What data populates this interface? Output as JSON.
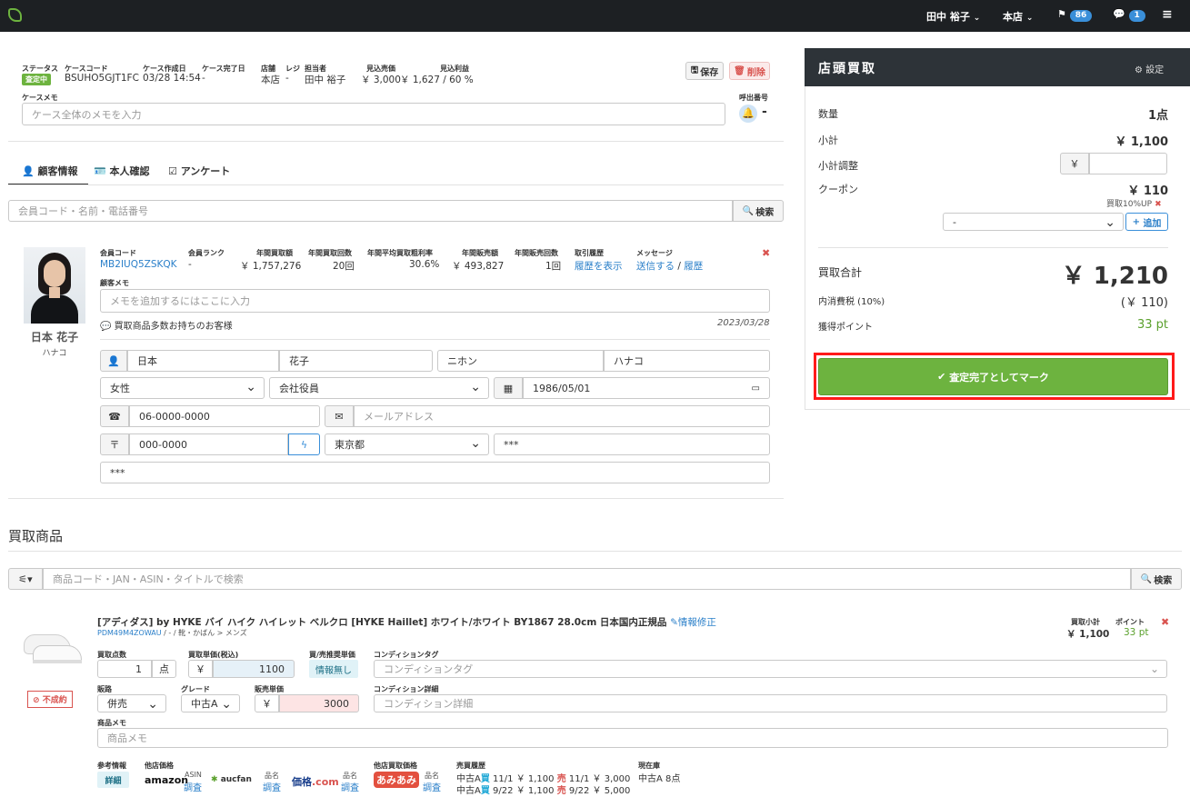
{
  "topbar": {
    "user": "田中 裕子",
    "store": "本店",
    "flag_count": "86",
    "chat_count": "1"
  },
  "case": {
    "status_label": "ステータス",
    "status_value": "査定中",
    "code_label": "ケースコード",
    "code_value": "BSUHO5GJT1FC",
    "created_label": "ケース作成日",
    "created_value": "03/28 14:54",
    "done_label": "ケース完了日",
    "done_value": "-",
    "store_label": "店舗",
    "store_value": "本店",
    "register_label": "レジ",
    "register_value": "-",
    "staff_label": "担当者",
    "staff_value": "田中 裕子",
    "est_sale_label": "見込売価",
    "est_sale_value": "￥ 3,000",
    "est_profit_label": "見込利益",
    "est_profit_value": "￥ 1,627 / 60 %",
    "save_label": "保存",
    "delete_label": "削除",
    "memo_label": "ケースメモ",
    "memo_placeholder": "ケース全体のメモを入力",
    "call_label": "呼出番号",
    "call_value": "-"
  },
  "tabs": [
    {
      "label": "顧客情報"
    },
    {
      "label": "本人確認"
    },
    {
      "label": "アンケート"
    }
  ],
  "member_search": {
    "placeholder": "会員コード・名前・電話番号",
    "button": "検索"
  },
  "customer": {
    "name": "日本 花子",
    "kana": "ハナコ",
    "member_code_label": "会員コード",
    "member_code": "MB2IUQ5ZSKQK",
    "rank_label": "会員ランク",
    "rank": "-",
    "annual_buy_label": "年間買取額",
    "annual_buy": "￥ 1,757,276",
    "annual_buy_count_label": "年間買取回数",
    "annual_buy_count": "20回",
    "avg_margin_label": "年間平均買取粗利率",
    "avg_margin": "30.6%",
    "annual_sale_label": "年間販売額",
    "annual_sale": "￥ 493,827",
    "annual_sale_count_label": "年間販売回数",
    "annual_sale_count": "1回",
    "history_label": "取引履歴",
    "history_link": "履歴を表示",
    "message_label": "メッセージ",
    "message_send": "送信する",
    "message_sep": "/",
    "message_history": "履歴",
    "memo_label": "顧客メモ",
    "memo_placeholder": "メモを追加するにはここに入力",
    "note": "買取商品多数お持ちのお客様",
    "note_date": "2023/03/28",
    "last_name": "日本",
    "first_name": "花子",
    "last_kana": "ニホン",
    "first_kana": "ハナコ",
    "gender": "女性",
    "occupation": "会社役員",
    "birthday": "1986/05/01",
    "phone": "06-0000-0000",
    "email_placeholder": "メールアドレス",
    "zip": "000-0000",
    "prefecture": "東京都",
    "address1": "***",
    "address2": "***"
  },
  "items_section": {
    "title": "買取商品",
    "search_placeholder": "商品コード・JAN・ASIN・タイトルで検索",
    "search_button": "検索"
  },
  "item": {
    "title": "[アディダス] by HYKE バイ ハイク ハイレット ベルクロ [HYKE Haillet] ホワイト/ホワイト BY1867 28.0cm 日本国内正規品",
    "edit_link": "情報修正",
    "code": "PDM49M4ZOWAU",
    "category": " / - / 靴・かばん > メンズ",
    "subtotal_label": "買取小計",
    "subtotal": "￥ 1,100",
    "points_label": "ポイント",
    "points": "33 pt",
    "status_badge": "不成約",
    "qty_label": "買取点数",
    "qty": "1",
    "qty_unit": "点",
    "unit_price_label": "買取単価(税込)",
    "unit_price": "1100",
    "yen": "￥",
    "recommend_label": "買/売推奨単価",
    "recommend_value": "情報無し",
    "condition_tag_label": "コンディションタグ",
    "condition_tag_placeholder": "コンディションタグ",
    "channel_label": "販路",
    "channel": "併売",
    "grade_label": "グレード",
    "grade": "中古A",
    "sale_price_label": "販売単価",
    "sale_price": "3000",
    "condition_detail_label": "コンディション詳細",
    "condition_detail_placeholder": "コンディション詳細",
    "memo_label": "商品メモ",
    "memo_placeholder": "商品メモ",
    "ref_label": "参考情報",
    "ref_button": "詳細",
    "other_store_label": "他店価格",
    "amazon_logo": "amazon",
    "amazon_sub": "ASIN",
    "amazon_link": "調査",
    "aucfan_logo": "aucfan",
    "aucfan_sub": "品名",
    "aucfan_link": "調査",
    "kakaku_logo_a": "価格",
    "kakaku_logo_b": ".com",
    "kakaku_sub": "品名",
    "kakaku_link": "調査",
    "other_buy_label": "他店買取価格",
    "amiami_logo": "あみあみ",
    "amiami_sub": "品名",
    "amiami_link": "調査",
    "history_label": "売買履歴",
    "history": [
      {
        "grade": "中古A",
        "buy": "買",
        "buy_date": "11/1",
        "buy_price": "￥ 1,100",
        "sell": "売",
        "sell_date": "11/1",
        "sell_price": "￥ 3,000"
      },
      {
        "grade": "中古A",
        "buy": "買",
        "buy_date": "9/22",
        "buy_price": "￥ 1,100",
        "sell": "売",
        "sell_date": "9/22",
        "sell_price": "￥ 5,000"
      }
    ],
    "stock_label": "現在庫",
    "stock_value": "中古A 8点"
  },
  "panel": {
    "title": "店頭買取",
    "settings": "設定",
    "qty_label": "数量",
    "qty_value": "1点",
    "subtotal_label": "小計",
    "subtotal_value": "￥ 1,100",
    "adjust_label": "小計調整",
    "adjust_yen": "￥",
    "coupon_label": "クーポン",
    "coupon_value": "￥ 110",
    "coupon_note": "買取10%UP",
    "coupon_select": "-",
    "add_button": "追加",
    "total_label": "買取合計",
    "total_value": "￥ 1,210",
    "tax_label": "内消費税 (10%)",
    "tax_value": "(￥ 110)",
    "points_label": "獲得ポイント",
    "points_value": "33 pt",
    "complete_button": "査定完了としてマーク"
  },
  "colors": {
    "topbar": "#1d2023",
    "accent_green": "#6db33f",
    "link_blue": "#2a7fc9",
    "danger_red": "#d9534f",
    "highlight_red": "#ff1a1a"
  }
}
